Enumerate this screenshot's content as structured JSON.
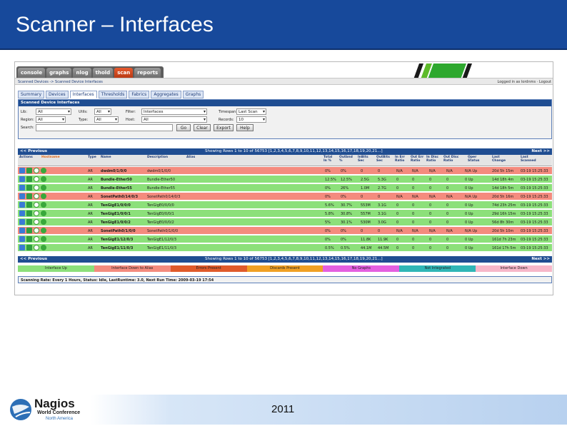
{
  "slide": {
    "title": "Scanner – Interfaces",
    "year": "2011"
  },
  "logo": {
    "name": "Nagios",
    "line2": "World Conference",
    "line3": "North America"
  },
  "colors": {
    "header": "#17499b",
    "green_row": "#8ce07a",
    "red_row": "#f48b7e",
    "active_tab": "#d24a1e"
  },
  "app": {
    "tabs": [
      "console",
      "graphs",
      "nlog",
      "thold",
      "scan",
      "reports"
    ],
    "active_tab": "scan",
    "breadcrumb": "Scanned Devices -> Scanned Device Interfaces",
    "login": "Logged in as lordnms · Logout",
    "subtabs": [
      "Summary",
      "Devices",
      "Interfaces",
      "Thresholds",
      "Fabrics",
      "Aggregates",
      "Graphs"
    ],
    "active_subtab": "Interfaces",
    "filter": {
      "title": "Scanned Device Interfaces",
      "lib_label": "Lib:",
      "lib_value": "All",
      "utils_label": "Utils:",
      "utils_value": "All",
      "filter_label": "Filter:",
      "filter_value": "Interfaces",
      "timespan_label": "Timespan:",
      "timespan_value": "Last Scan",
      "region_label": "Region:",
      "region_value": "All",
      "type_label": "Type:",
      "type_value": "All",
      "host_label": "Host:",
      "host_value": "All",
      "records_label": "Records:",
      "records_value": "10",
      "search_label": "Search:",
      "search_value": "",
      "go": "Go",
      "clear": "Clear",
      "export": "Export",
      "help": "Help"
    },
    "nav_top": {
      "prev": "<< Previous",
      "showing": "Showing Rows 1 to 10 of 56753 [1,2,3,4,5,6,7,8,9,10,11,12,13,14,15,16,17,18,19,20,21...]",
      "next": "Next >>"
    },
    "nav_bottom": {
      "prev": "<< Previous",
      "showing": "Showing Rows 1 to 10 of 56753 [1,2,3,4,5,6,7,8,9,10,11,12,13,14,15,16,17,18,19,20,21...]",
      "next": "Next >>"
    },
    "columns": [
      "Actions",
      "Hostname",
      "Type",
      "Name",
      "Description",
      "Alias",
      "Total In %",
      "Outbnd %",
      "InBits Sec",
      "OutBits Sec",
      "In Err Ratio",
      "Out Err Ratio",
      "In Disc Ratio",
      "Out Disc Ratio",
      "Oper Status",
      "Last Change",
      "Last Scanned"
    ],
    "rows": [
      {
        "status": "red",
        "type": "AR",
        "name": "dwdm0/1/0/0",
        "desc": "dwdm0/1/0/0",
        "in": "0%",
        "out": "0%",
        "inb": "0",
        "outb": "0",
        "ie": "N/A",
        "oe": "N/A",
        "id": "N/A",
        "od": "N/A",
        "oper": "N/A Up",
        "chg": "20d 5h 15m",
        "scan": "03-19 15:25:33"
      },
      {
        "status": "green",
        "type": "AR",
        "name": "Bundle-Ether50",
        "desc": "Bundle-Ether50",
        "in": "12.5%",
        "out": "12.5%",
        "inb": "2.5G",
        "outb": "5.3G",
        "ie": "0",
        "oe": "0",
        "id": "0",
        "od": "0",
        "oper": "0 Up",
        "chg": "14d 18h 4m",
        "scan": "03-19 15:25:33"
      },
      {
        "status": "green",
        "type": "AR",
        "name": "Bundle-Ether55",
        "desc": "Bundle-Ether55",
        "in": "0%",
        "out": "26%",
        "inb": "1.0M",
        "outb": "2.7G",
        "ie": "0",
        "oe": "0",
        "id": "0",
        "od": "0",
        "oper": "0 Up",
        "chg": "14d 18h 5m",
        "scan": "03-19 15:25:33"
      },
      {
        "status": "red",
        "type": "AR",
        "name": "SonetPath0/14/0/3",
        "desc": "SonetPath0/14/0/3",
        "in": "0%",
        "out": "0%",
        "inb": "0",
        "outb": "0",
        "ie": "N/A",
        "oe": "N/A",
        "id": "N/A",
        "od": "N/A",
        "oper": "N/A Up",
        "chg": "20d 5h 16m",
        "scan": "03-19 15:25:33"
      },
      {
        "status": "green",
        "type": "AR",
        "name": "TenGigE1/0/0/0",
        "desc": "TenGigE0/0/0/0",
        "in": "5.6%",
        "out": "30.7%",
        "inb": "553M",
        "outb": "3.1G",
        "ie": "0",
        "oe": "0",
        "id": "0",
        "od": "0",
        "oper": "0 Up",
        "chg": "74d 23h 25m",
        "scan": "03-19 15:25:33"
      },
      {
        "status": "green",
        "type": "AR",
        "name": "TenGigE1/0/0/1",
        "desc": "TenGigE0/0/0/1",
        "in": "5.8%",
        "out": "30.8%",
        "inb": "557M",
        "outb": "3.1G",
        "ie": "0",
        "oe": "0",
        "id": "0",
        "od": "0",
        "oper": "0 Up",
        "chg": "29d 16h 15m",
        "scan": "03-19 15:25:33"
      },
      {
        "status": "green",
        "type": "AR",
        "name": "TenGigE1/0/0/2",
        "desc": "TenGigE0/0/0/2",
        "in": "5%",
        "out": "30.1%",
        "inb": "530M",
        "outb": "3.0G",
        "ie": "0",
        "oe": "0",
        "id": "0",
        "od": "0",
        "oper": "0 Up",
        "chg": "56d 8h 30m",
        "scan": "03-19 15:25:33"
      },
      {
        "status": "red",
        "type": "AR",
        "name": "SonetPath0/1/0/0",
        "desc": "SonetPath0/1/0/0",
        "in": "0%",
        "out": "0%",
        "inb": "0",
        "outb": "0",
        "ie": "N/A",
        "oe": "N/A",
        "id": "N/A",
        "od": "N/A",
        "oper": "N/A Up",
        "chg": "20d 5h 10m",
        "scan": "03-19 15:25:33"
      },
      {
        "status": "green",
        "type": "AR",
        "name": "TenGigE1/12/0/3",
        "desc": "TenGigE1/12/0/3",
        "in": "0%",
        "out": "0%",
        "inb": "11.8K",
        "outb": "11.9K",
        "ie": "0",
        "oe": "0",
        "id": "0",
        "od": "0",
        "oper": "0 Up",
        "chg": "161d 7h 23m",
        "scan": "03-19 15:25:33"
      },
      {
        "status": "green",
        "type": "AR",
        "name": "TenGigE1/11/0/3",
        "desc": "TenGigE1/11/0/3",
        "in": "0.5%",
        "out": "0.5%",
        "inb": "44.1M",
        "outb": "44.5M",
        "ie": "0",
        "oe": "0",
        "id": "0",
        "od": "0",
        "oper": "0 Up",
        "chg": "161d 17h 5m",
        "scan": "03-19 15:25:33"
      }
    ],
    "legend": [
      {
        "label": "Interface Up",
        "color": "#8ce07a"
      },
      {
        "label": "Interface Down to Alias",
        "color": "#f48b7e"
      },
      {
        "label": "Errors Present",
        "color": "#e05a2a"
      },
      {
        "label": "Discards Present",
        "color": "#f0a023"
      },
      {
        "label": "No Graphs",
        "color": "#e45fe0"
      },
      {
        "label": "Not Integrated",
        "color": "#2fb6b6"
      },
      {
        "label": "Interface Down",
        "color": "#f7b7c9"
      }
    ],
    "scanning": "Scanning Rate: Every 1 Hours, Status: Idle, LastRuntime: 3.0, Next Run Time: 2009-03-19 17:54"
  }
}
